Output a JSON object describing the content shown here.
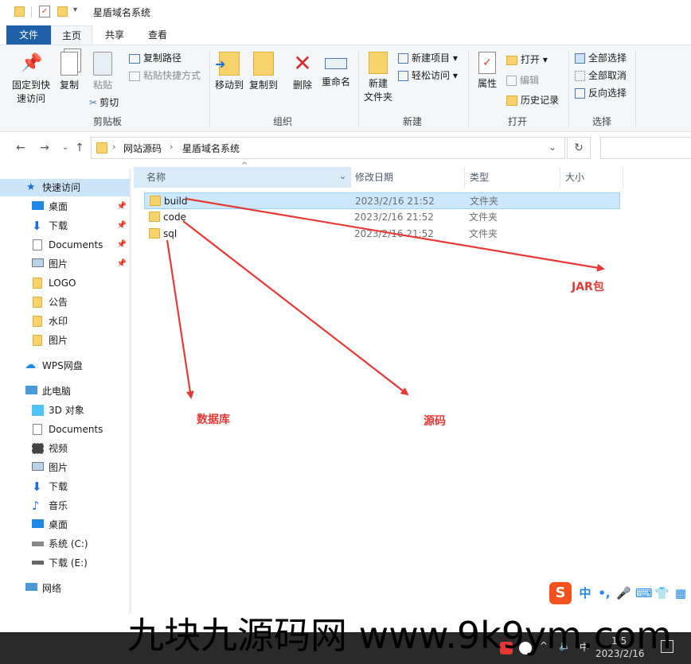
{
  "window": {
    "title": "星盾域名系统"
  },
  "ribbon_tabs": [
    "文件",
    "主页",
    "共享",
    "查看"
  ],
  "ribbon": {
    "clipboard": {
      "label": "剪贴板",
      "pin_quick_access": "固定到快\n速访问",
      "copy": "复制",
      "paste": "粘贴",
      "copy_path": "复制路径",
      "paste_shortcut": "粘贴快捷方式",
      "cut": "剪切"
    },
    "organize": {
      "label": "组织",
      "move_to": "移动到",
      "copy_to": "复制到",
      "delete": "删除",
      "rename": "重命名"
    },
    "new": {
      "label": "新建",
      "new_folder": "新建\n文件夹",
      "new_item": "新建项目",
      "easy_access": "轻松访问"
    },
    "open": {
      "label": "打开",
      "properties": "属性",
      "open": "打开",
      "edit": "编辑",
      "history": "历史记录"
    },
    "select": {
      "label": "选择",
      "select_all": "全部选择",
      "select_none": "全部取消",
      "invert": "反向选择"
    }
  },
  "address": {
    "crumbs": [
      "网站源码",
      "星盾域名系统"
    ]
  },
  "columns": {
    "name": "名称",
    "modified": "修改日期",
    "type": "类型",
    "size": "大小"
  },
  "files": [
    {
      "name": "build",
      "modified": "2023/2/16 21:52",
      "type": "文件夹"
    },
    {
      "name": "code",
      "modified": "2023/2/16 21:52",
      "type": "文件夹"
    },
    {
      "name": "sql",
      "modified": "2023/2/16 21:52",
      "type": "文件夹"
    }
  ],
  "nav": {
    "quick_access": "快速访问",
    "quick_items": [
      "桌面",
      "下载",
      "Documents",
      "图片",
      "LOGO",
      "公告",
      "水印",
      "图片"
    ],
    "wps": "WPS网盘",
    "this_pc": "此电脑",
    "pc_items": [
      "3D 对象",
      "Documents",
      "视频",
      "图片",
      "下载",
      "音乐",
      "桌面",
      "系统 (C:)",
      "下载 (E:)"
    ],
    "network": "网络"
  },
  "annotations": {
    "jar": "JAR包",
    "db": "数据库",
    "src": "源码"
  },
  "annotation_color": "#e53935",
  "ime": {
    "lang": "中",
    "punct": "•,"
  },
  "watermark": "九块九源码网 www.9k9ym.com",
  "taskbar": {
    "date": "2023/2/16",
    "time": "1:5"
  }
}
